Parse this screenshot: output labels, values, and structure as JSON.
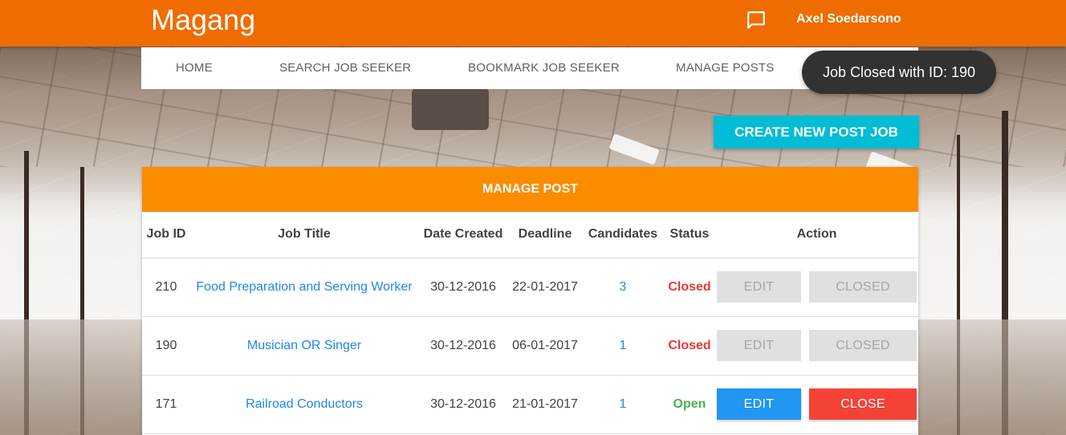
{
  "header": {
    "brand": "Magang",
    "chat_icon": "chat-bubble-icon",
    "user_name": "Axel Soedarsono"
  },
  "nav": {
    "items": [
      "HOME",
      "SEARCH JOB SEEKER",
      "BOOKMARK JOB SEEKER",
      "MANAGE POSTS"
    ]
  },
  "toast": "Job Closed with ID: 190",
  "create_button": "CREATE NEW POST JOB",
  "panel": {
    "title": "MANAGE POST",
    "columns": [
      "Job ID",
      "Job Title",
      "Date Created",
      "Deadline",
      "Candidates",
      "Status",
      "Action"
    ],
    "rows": [
      {
        "id": "210",
        "title": "Food Preparation and Serving Worker",
        "created": "30-12-2016",
        "deadline": "22-01-2017",
        "candidates": "3",
        "status": "Closed",
        "edit": "EDIT",
        "close": "CLOSED"
      },
      {
        "id": "190",
        "title": "Musician OR Singer",
        "created": "30-12-2016",
        "deadline": "06-01-2017",
        "candidates": "1",
        "status": "Closed",
        "edit": "EDIT",
        "close": "CLOSED"
      },
      {
        "id": "171",
        "title": "Railroad Conductors",
        "created": "30-12-2016",
        "deadline": "21-01-2017",
        "candidates": "1",
        "status": "Open",
        "edit": "EDIT",
        "close": "CLOSE"
      }
    ]
  },
  "colors": {
    "topbar": "#ef6c00",
    "panel_header": "#fb8c00",
    "create_button": "#00bcd4",
    "edit_button": "#2196f3",
    "close_button": "#f44336",
    "status_closed": "#e53935",
    "status_open": "#4caf50",
    "link": "#1e88e5"
  }
}
